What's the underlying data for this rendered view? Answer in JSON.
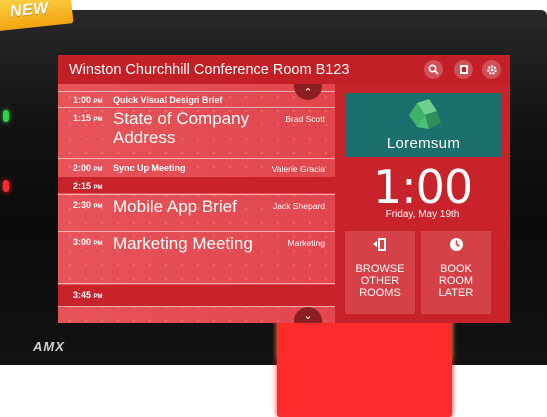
{
  "banner": {
    "text": "NEW"
  },
  "room": {
    "title": "Winston Churchhill Conference Room B123"
  },
  "icons": {
    "search": "search-icon",
    "calendar": "calendar-icon",
    "settings": "gear-icon"
  },
  "schedule": [
    {
      "time": "1:00",
      "ampm": "PM",
      "title": "Quick Visual Design Brief",
      "who": "",
      "style": "small"
    },
    {
      "time": "1:15",
      "ampm": "PM",
      "title": "State of Company Address",
      "who": "Brad Scott",
      "style": "big"
    },
    {
      "time": "2:00",
      "ampm": "PM",
      "title": "Sync Up Meeting",
      "who": "Valerie Gracia",
      "style": "small"
    },
    {
      "time": "2:15",
      "ampm": "PM",
      "title": "",
      "who": "",
      "style": "free"
    },
    {
      "time": "2:30",
      "ampm": "PM",
      "title": "Mobile App Brief",
      "who": "Jack Shepard",
      "style": "big"
    },
    {
      "time": "3:00",
      "ampm": "PM",
      "title": "Marketing Meeting",
      "who": "Marketing",
      "style": "big"
    },
    {
      "time": "3:45",
      "ampm": "PM",
      "title": "",
      "who": "",
      "style": "free"
    }
  ],
  "logo": {
    "text": "Loremsum"
  },
  "clock": {
    "time": "1:00",
    "date": "Friday, May 19th"
  },
  "actions": {
    "browse": {
      "label": "BROWSE\nOTHER\nROOMS",
      "icon": "door-icon"
    },
    "book": {
      "label": "BOOK\nROOM\nLATER",
      "icon": "clock-icon"
    }
  },
  "brand": {
    "text": "AMX"
  },
  "colors": {
    "accent": "#c8232a",
    "schedule_bg": "#e2464d",
    "logo_bg": "#1b6f6d"
  }
}
